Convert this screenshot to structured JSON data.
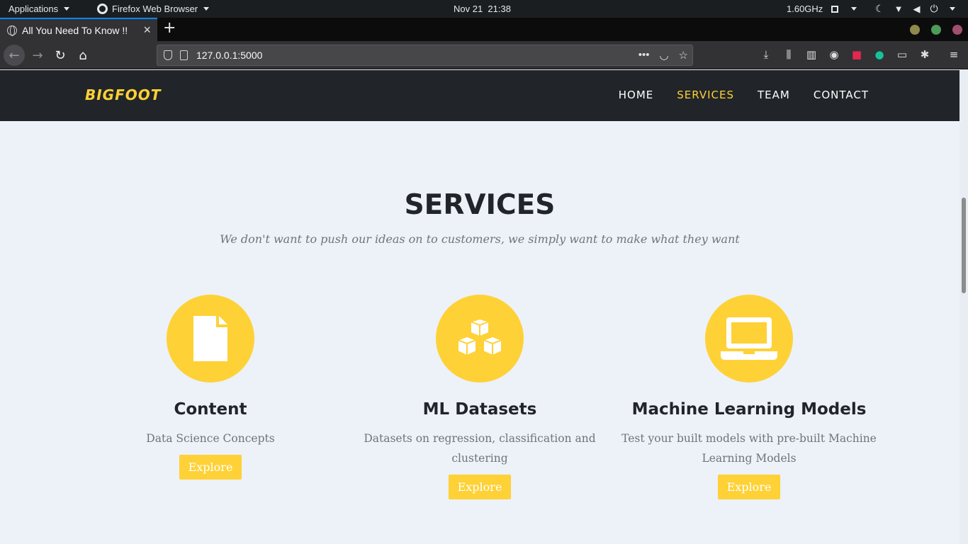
{
  "system_panel": {
    "applications": "Applications",
    "active_app": "Firefox Web Browser",
    "datetime": "Nov 21  21:38",
    "cpu_freq": "1.60GHz"
  },
  "browser": {
    "tab_title": "All You Need To Know !!",
    "url": "127.0.0.1:5000"
  },
  "site": {
    "brand": "BIGFOOT",
    "menu": [
      {
        "label": "HOME"
      },
      {
        "label": "SERVICES",
        "active": true
      },
      {
        "label": "TEAM"
      },
      {
        "label": "CONTACT"
      }
    ],
    "section_title": "SERVICES",
    "section_subtitle": "We don't want to push our ideas on to customers, we simply want to make what they want",
    "services": [
      {
        "icon": "file-icon",
        "title": "Content",
        "desc": "Data Science Concepts",
        "button": "Explore"
      },
      {
        "icon": "cubes-icon",
        "title": "ML Datasets",
        "desc": "Datasets on regression, classification and clustering",
        "button": "Explore"
      },
      {
        "icon": "laptop-icon",
        "title": "Machine Learning Models",
        "desc": "Test your built models with pre-built Machine Learning Models",
        "button": "Explore"
      }
    ]
  },
  "colors": {
    "accent": "#fed136",
    "nav_bg": "#212529",
    "page_bg": "#edf1f8",
    "tab_indicator": "#0a84ff"
  }
}
